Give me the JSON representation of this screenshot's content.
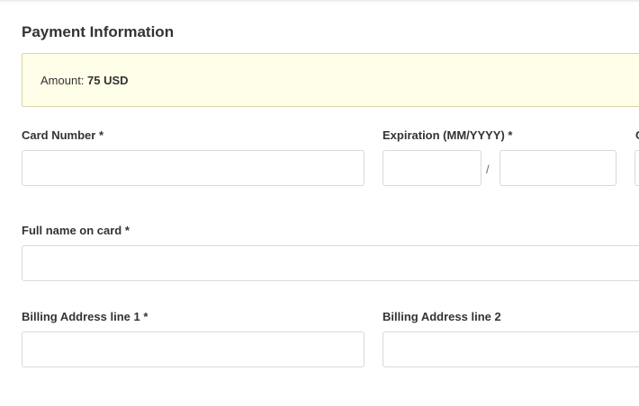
{
  "section": {
    "title": "Payment Information"
  },
  "amount": {
    "label": "Amount:",
    "value": "75 USD"
  },
  "form": {
    "card_number": {
      "label": "Card Number *",
      "value": "",
      "placeholder": ""
    },
    "expiration": {
      "label": "Expiration (MM/YYYY) *",
      "month": {
        "value": "",
        "placeholder": ""
      },
      "separator": "/",
      "year": {
        "value": "",
        "placeholder": ""
      }
    },
    "cvc": {
      "label": "C",
      "value": "",
      "placeholder": ""
    },
    "full_name": {
      "label": "Full name on card *",
      "value": "",
      "placeholder": ""
    },
    "billing_line1": {
      "label": "Billing Address line 1 *",
      "value": "",
      "placeholder": ""
    },
    "billing_line2": {
      "label": "Billing Address line 2",
      "value": "",
      "placeholder": ""
    }
  }
}
